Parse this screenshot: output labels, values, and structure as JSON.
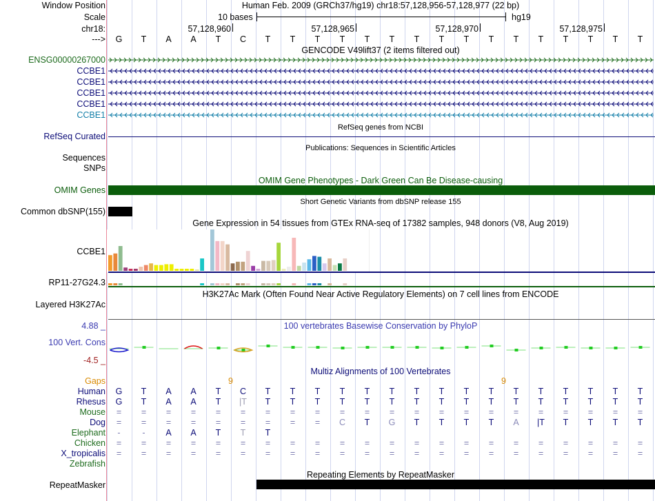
{
  "header": {
    "window_position_label": "Window Position",
    "scale_label": "Scale",
    "chrom_label": "chr18:",
    "arrow_label": "--->",
    "assembly_title": "Human Feb. 2009 (GRCh37/hg19)   chr18:57,128,956-57,128,977 (22 bp)",
    "scale_text": "10 bases",
    "scale_db": "hg19",
    "positions": [
      "57,128,960",
      "57,128,965",
      "57,128,970",
      "57,128,975"
    ]
  },
  "sequence": [
    "G",
    "T",
    "A",
    "A",
    "T",
    "C",
    "T",
    "T",
    "T",
    "T",
    "T",
    "T",
    "T",
    "T",
    "T",
    "T",
    "T",
    "T",
    "T",
    "T",
    "T",
    "T"
  ],
  "gencode": {
    "title": "GENCODE V49lift37 (2 items filtered out)",
    "rows": [
      {
        "name": "ENSG00000267000",
        "color": "#1d6b1d",
        "dir": "fwd"
      },
      {
        "name": "CCBE1",
        "color": "#0c0c78",
        "dir": "rev"
      },
      {
        "name": "CCBE1",
        "color": "#0c0c78",
        "dir": "rev"
      },
      {
        "name": "CCBE1",
        "color": "#0c0c78",
        "dir": "rev"
      },
      {
        "name": "CCBE1",
        "color": "#0c0c78",
        "dir": "rev"
      },
      {
        "name": "CCBE1",
        "color": "#127ea8",
        "dir": "rev"
      }
    ]
  },
  "refseq": {
    "label": "RefSeq Curated",
    "title": "RefSeq genes from NCBI"
  },
  "publications": {
    "title": "Publications: Sequences in Scientific Articles",
    "seq_label": "Sequences",
    "snp_label": "SNPs"
  },
  "omim": {
    "title": "OMIM Gene Phenotypes - Dark Green Can Be Disease-causing",
    "label": "OMIM Genes",
    "color": "#0b5d0b"
  },
  "dbsnp": {
    "title": "Short Genetic Variants from dbSNP release 155",
    "label": "Common dbSNP(155)"
  },
  "gtex": {
    "title": "Gene Expression in 54 tissues from GTEx RNA-seq of 17382 samples, 948 donors (V8, Aug 2019)",
    "gene1": "CCBE1",
    "gene2": "RP11-27G24.3",
    "bars": [
      {
        "v": 0.38,
        "c": "#f29b2b"
      },
      {
        "v": 0.42,
        "c": "#e8883a"
      },
      {
        "v": 0.6,
        "c": "#8fbc8f"
      },
      {
        "v": 0.08,
        "c": "#9b3d7a"
      },
      {
        "v": 0.05,
        "c": "#c8305a"
      },
      {
        "v": 0.05,
        "c": "#a23a6a"
      },
      {
        "v": 0.1,
        "c": "#eec3aa"
      },
      {
        "v": 0.14,
        "c": "#ee8866"
      },
      {
        "v": 0.18,
        "c": "#e7b74a"
      },
      {
        "v": 0.14,
        "c": "#eeee00"
      },
      {
        "v": 0.14,
        "c": "#eeee00"
      },
      {
        "v": 0.16,
        "c": "#eeee00"
      },
      {
        "v": 0.16,
        "c": "#eeee00"
      },
      {
        "v": 0.05,
        "c": "#eeee00"
      },
      {
        "v": 0.05,
        "c": "#eeee00"
      },
      {
        "v": 0.05,
        "c": "#eeee00"
      },
      {
        "v": 0.05,
        "c": "#eeee00"
      },
      {
        "v": 0.03,
        "c": "#e6e6a8"
      },
      {
        "v": 0.3,
        "c": "#1bc7c7"
      },
      {
        "v": 0.05,
        "c": "#ffffff"
      },
      {
        "v": 1.0,
        "c": "#a3c7d8"
      },
      {
        "v": 0.72,
        "c": "#f3b8c6"
      },
      {
        "v": 0.72,
        "c": "#f3d5c8"
      },
      {
        "v": 0.64,
        "c": "#d8b9a0"
      },
      {
        "v": 0.18,
        "c": "#8c6a4e"
      },
      {
        "v": 0.22,
        "c": "#b0906a"
      },
      {
        "v": 0.22,
        "c": "#c2a380"
      },
      {
        "v": 0.48,
        "c": "#efd3d3"
      },
      {
        "v": 0.12,
        "c": "#9a3da7"
      },
      {
        "v": 0.05,
        "c": "#d3a7d7"
      },
      {
        "v": 0.24,
        "c": "#c9b9a5"
      },
      {
        "v": 0.24,
        "c": "#d7c9b9"
      },
      {
        "v": 0.26,
        "c": "#e0d0c0"
      },
      {
        "v": 0.68,
        "c": "#a6d63c"
      },
      {
        "v": 0.05,
        "c": "#ececb8"
      },
      {
        "v": 0.1,
        "c": "#ededed"
      },
      {
        "v": 0.8,
        "c": "#f7b8b8"
      },
      {
        "v": 0.12,
        "c": "#bcd8a0"
      },
      {
        "v": 0.2,
        "c": "#c7e3f0"
      },
      {
        "v": 0.28,
        "c": "#5bb8e8"
      },
      {
        "v": 0.36,
        "c": "#2b5fc5"
      },
      {
        "v": 0.34,
        "c": "#1a8da8"
      },
      {
        "v": 0.18,
        "c": "#d5c8ee"
      },
      {
        "v": 0.3,
        "c": "#d8b89c"
      },
      {
        "v": 0.14,
        "c": "#c7e0b3"
      },
      {
        "v": 0.18,
        "c": "#0c7a45"
      },
      {
        "v": 0.3,
        "c": "#e8d0c8"
      }
    ]
  },
  "h3k27ac": {
    "title": "H3K27Ac Mark (Often Found Near Active Regulatory Elements) on 7 cell lines from ENCODE",
    "label": "Layered H3K27Ac"
  },
  "phylop": {
    "title": "100 vertebrates Basewise Conservation by PhyloP",
    "label": "100 Vert. Cons",
    "max": "4.88 _",
    "min": "-4.5 _"
  },
  "multiz": {
    "title": "Multiz Alignments of 100 Vertebrates",
    "gaps_label": "Gaps",
    "gap_marks": [
      {
        "pos": 5,
        "text": "9"
      },
      {
        "pos": 16,
        "text": "9"
      }
    ],
    "species": [
      {
        "name": "Human",
        "color": "#0c0c78",
        "seq": [
          "G",
          "T",
          "A",
          "A",
          "T",
          "C",
          "T",
          "T",
          "T",
          "T",
          "T",
          "T",
          "T",
          "T",
          "T",
          "T",
          "T",
          "T",
          "T",
          "T",
          "T",
          "T"
        ]
      },
      {
        "name": "Rhesus",
        "color": "#0c0c78",
        "seq": [
          "G",
          "T",
          "A",
          "A",
          "T",
          "|T",
          "T",
          "T",
          "T",
          "T",
          "T",
          "T",
          "T",
          "T",
          "T",
          "T",
          "T",
          "T",
          "T",
          "T",
          "T",
          "T"
        ]
      },
      {
        "name": "Mouse",
        "color": "#1d6b1d",
        "seq": [
          "=",
          "=",
          "=",
          "=",
          "=",
          "=",
          "=",
          "=",
          "=",
          "=",
          "=",
          "=",
          "=",
          "=",
          "=",
          "=",
          "=",
          "=",
          "=",
          "=",
          "=",
          "="
        ]
      },
      {
        "name": "Dog",
        "color": "#0c0c78",
        "seq": [
          "=",
          "=",
          "=",
          "=",
          "=",
          "=",
          "=",
          "=",
          "=",
          "C",
          "T",
          "G",
          "T",
          "T",
          "T",
          "T",
          "A",
          "|T",
          "T",
          "T",
          "T",
          "T"
        ]
      },
      {
        "name": "Elephant",
        "color": "#1d6b1d",
        "seq": [
          "-",
          "-",
          "A",
          "A",
          "T",
          "T",
          "T",
          "",
          "",
          "",
          "",
          "",
          "",
          "",
          "",
          "",
          "",
          "",
          "",
          "",
          "",
          ""
        ]
      },
      {
        "name": "Chicken",
        "color": "#1d6b1d",
        "seq": [
          "=",
          "=",
          "=",
          "=",
          "=",
          "=",
          "=",
          "=",
          "=",
          "=",
          "=",
          "=",
          "=",
          "=",
          "=",
          "=",
          "=",
          "=",
          "=",
          "=",
          "=",
          "="
        ]
      },
      {
        "name": "X_tropicalis",
        "color": "#0c0c78",
        "seq": [
          "=",
          "=",
          "=",
          "=",
          "=",
          "=",
          "=",
          "=",
          "=",
          "=",
          "=",
          "=",
          "=",
          "=",
          "=",
          "=",
          "=",
          "=",
          "=",
          "=",
          "=",
          "="
        ]
      },
      {
        "name": "Zebrafish",
        "color": "#1d6b1d",
        "seq": []
      }
    ]
  },
  "repeatmasker": {
    "title": "Repeating Elements by RepeatMasker",
    "label": "RepeatMasker"
  }
}
